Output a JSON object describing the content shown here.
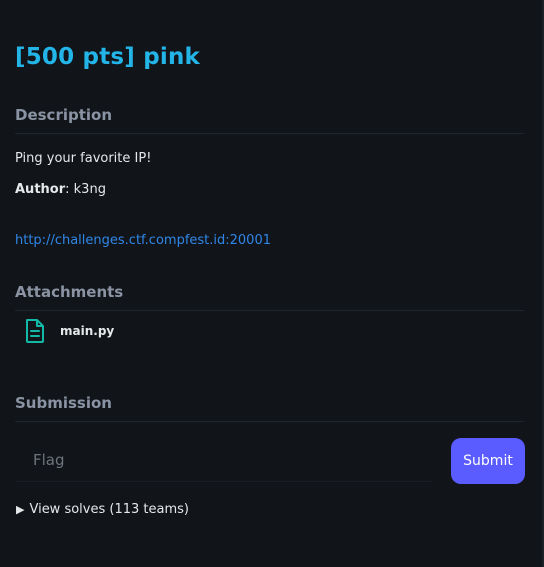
{
  "challenge": {
    "title": "[500 pts] pink"
  },
  "description": {
    "heading": "Description",
    "text": "Ping your favorite IP!",
    "author_label": "Author",
    "author_value": ": k3ng",
    "link": "http://challenges.ctf.compfest.id:20001"
  },
  "attachments": {
    "heading": "Attachments",
    "items": [
      {
        "name": "main.py",
        "icon": "file-icon"
      }
    ]
  },
  "submission": {
    "heading": "Submission",
    "flag_placeholder": "Flag",
    "submit_label": "Submit"
  },
  "solves": {
    "toggle_label": "View solves (113 teams)"
  },
  "colors": {
    "background": "#111519",
    "title": "#23b4e8",
    "heading": "#8a93a3",
    "link": "#2f86e8",
    "accent_button": "#5a5cff",
    "file_icon": "#14b8a6"
  }
}
